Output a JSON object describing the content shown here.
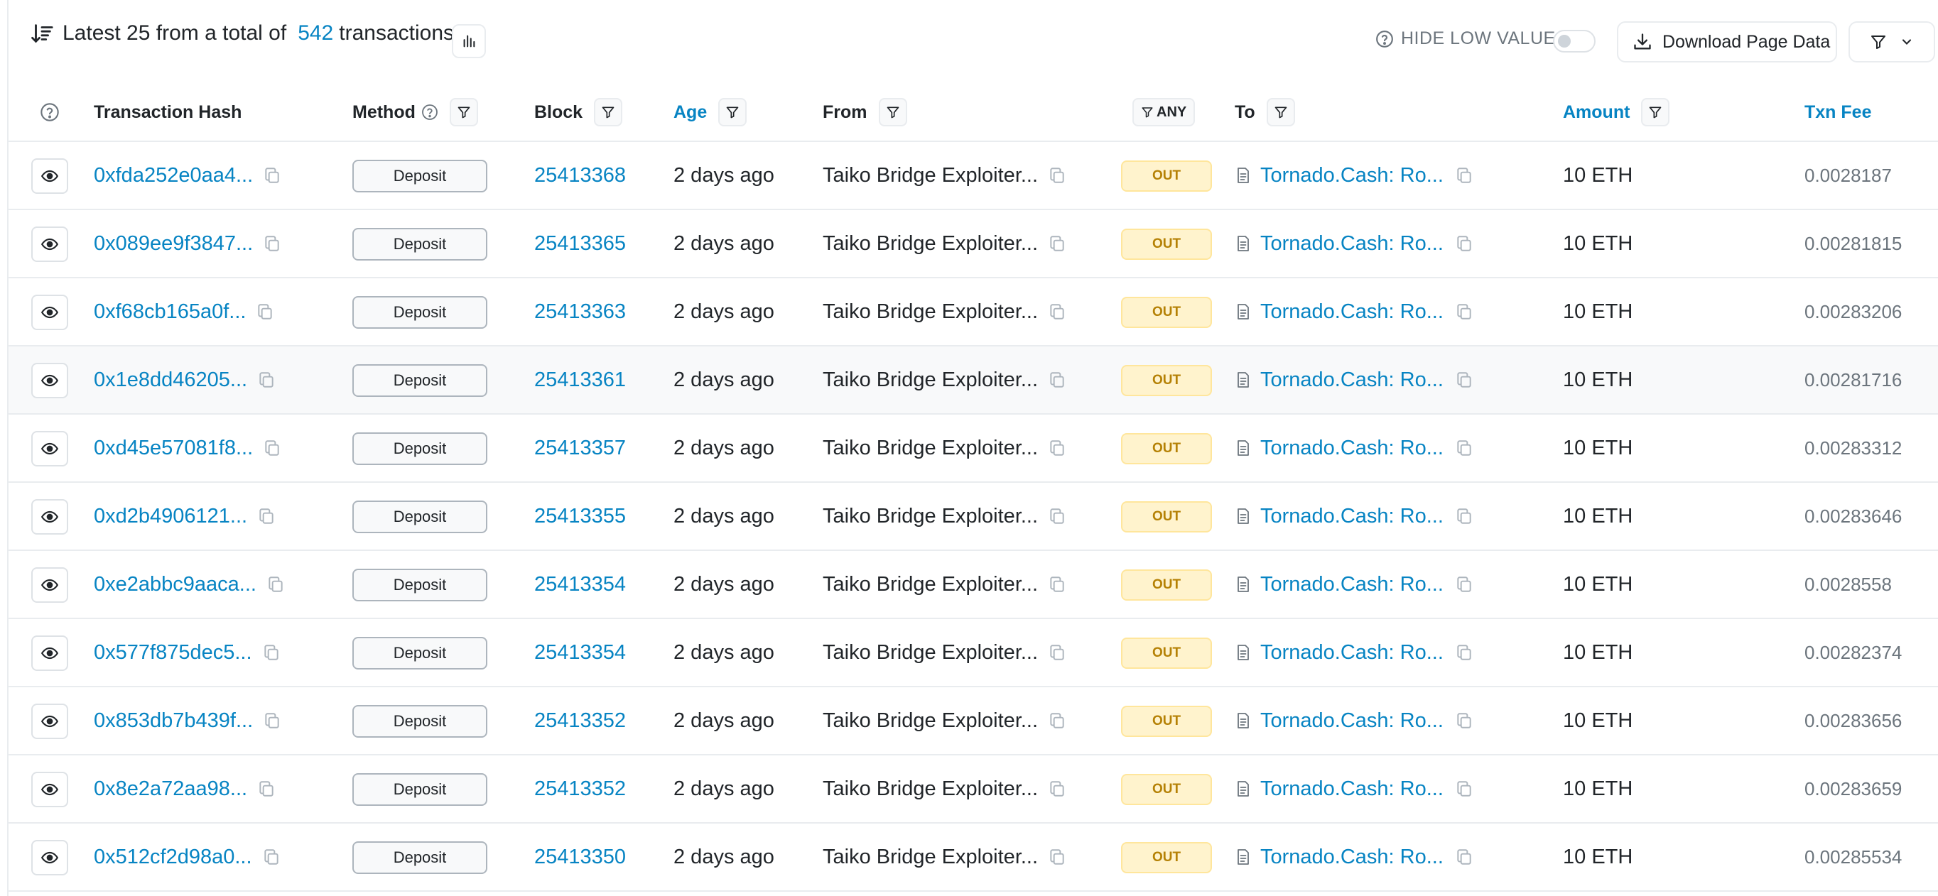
{
  "summary": {
    "prefix": "Latest 25 from a total of",
    "total": "542",
    "suffix": "transactions"
  },
  "toolbar": {
    "hide_low_value": "HIDE LOW VALUE",
    "download": "Download Page Data"
  },
  "columns": {
    "hash": "Transaction Hash",
    "method": "Method",
    "block": "Block",
    "age": "Age",
    "from": "From",
    "any": "ANY",
    "to": "To",
    "amount": "Amount",
    "fee": "Txn Fee"
  },
  "icons": [
    "sort-desc-icon",
    "bar-chart-icon",
    "help-circle-icon",
    "download-icon",
    "filter-icon",
    "chevron-down-icon",
    "eye-icon",
    "copy-icon",
    "contract-doc-icon"
  ],
  "colors": {
    "link": "#0784c3",
    "out_badge_bg": "#fff3cd",
    "out_badge_text": "#b58105",
    "row_highlight": "#f8f9fa"
  },
  "rows": [
    {
      "hash": "0xfda252e0aa4...",
      "method": "Deposit",
      "block": "25413368",
      "age": "2 days ago",
      "from": "Taiko Bridge Exploiter...",
      "dir": "OUT",
      "to": "Tornado.Cash: Ro...",
      "amount": "10 ETH",
      "fee": "0.0028187"
    },
    {
      "hash": "0x089ee9f3847...",
      "method": "Deposit",
      "block": "25413365",
      "age": "2 days ago",
      "from": "Taiko Bridge Exploiter...",
      "dir": "OUT",
      "to": "Tornado.Cash: Ro...",
      "amount": "10 ETH",
      "fee": "0.00281815"
    },
    {
      "hash": "0xf68cb165a0f...",
      "method": "Deposit",
      "block": "25413363",
      "age": "2 days ago",
      "from": "Taiko Bridge Exploiter...",
      "dir": "OUT",
      "to": "Tornado.Cash: Ro...",
      "amount": "10 ETH",
      "fee": "0.00283206"
    },
    {
      "hash": "0x1e8dd46205...",
      "method": "Deposit",
      "block": "25413361",
      "age": "2 days ago",
      "from": "Taiko Bridge Exploiter...",
      "dir": "OUT",
      "to": "Tornado.Cash: Ro...",
      "amount": "10 ETH",
      "fee": "0.00281716"
    },
    {
      "hash": "0xd45e57081f8...",
      "method": "Deposit",
      "block": "25413357",
      "age": "2 days ago",
      "from": "Taiko Bridge Exploiter...",
      "dir": "OUT",
      "to": "Tornado.Cash: Ro...",
      "amount": "10 ETH",
      "fee": "0.00283312"
    },
    {
      "hash": "0xd2b4906121...",
      "method": "Deposit",
      "block": "25413355",
      "age": "2 days ago",
      "from": "Taiko Bridge Exploiter...",
      "dir": "OUT",
      "to": "Tornado.Cash: Ro...",
      "amount": "10 ETH",
      "fee": "0.00283646"
    },
    {
      "hash": "0xe2abbc9aaca...",
      "method": "Deposit",
      "block": "25413354",
      "age": "2 days ago",
      "from": "Taiko Bridge Exploiter...",
      "dir": "OUT",
      "to": "Tornado.Cash: Ro...",
      "amount": "10 ETH",
      "fee": "0.0028558"
    },
    {
      "hash": "0x577f875dec5...",
      "method": "Deposit",
      "block": "25413354",
      "age": "2 days ago",
      "from": "Taiko Bridge Exploiter...",
      "dir": "OUT",
      "to": "Tornado.Cash: Ro...",
      "amount": "10 ETH",
      "fee": "0.00282374"
    },
    {
      "hash": "0x853db7b439f...",
      "method": "Deposit",
      "block": "25413352",
      "age": "2 days ago",
      "from": "Taiko Bridge Exploiter...",
      "dir": "OUT",
      "to": "Tornado.Cash: Ro...",
      "amount": "10 ETH",
      "fee": "0.00283656"
    },
    {
      "hash": "0x8e2a72aa98...",
      "method": "Deposit",
      "block": "25413352",
      "age": "2 days ago",
      "from": "Taiko Bridge Exploiter...",
      "dir": "OUT",
      "to": "Tornado.Cash: Ro...",
      "amount": "10 ETH",
      "fee": "0.00283659"
    },
    {
      "hash": "0x512cf2d98a0...",
      "method": "Deposit",
      "block": "25413350",
      "age": "2 days ago",
      "from": "Taiko Bridge Exploiter...",
      "dir": "OUT",
      "to": "Tornado.Cash: Ro...",
      "amount": "10 ETH",
      "fee": "0.00285534"
    }
  ]
}
